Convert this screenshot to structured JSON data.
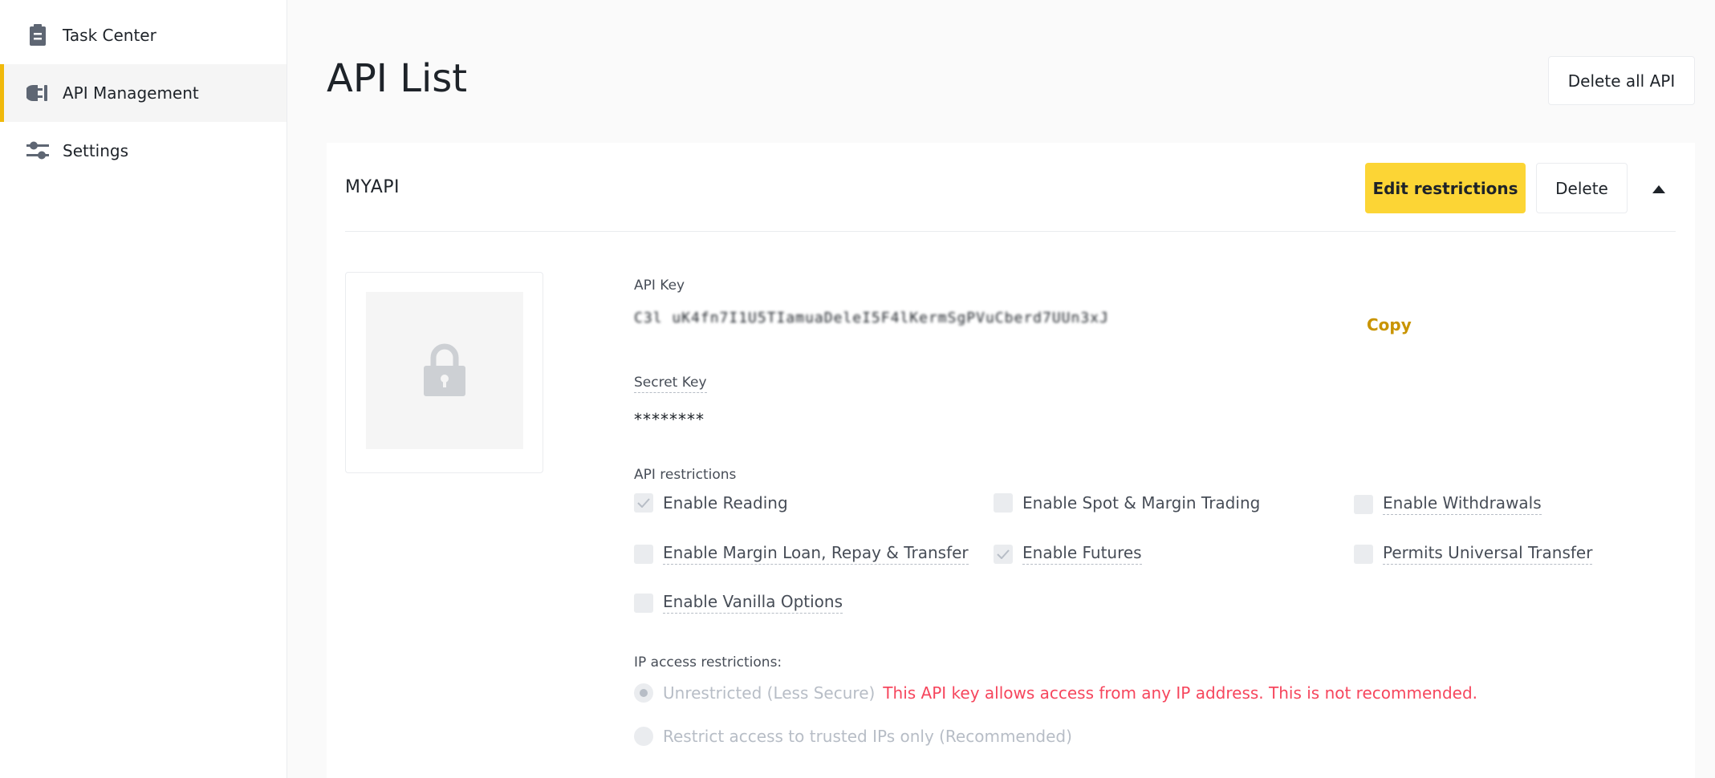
{
  "sidebar": {
    "items": [
      {
        "label": "Task Center",
        "icon": "clipboard-icon",
        "active": false
      },
      {
        "label": "API Management",
        "icon": "plug-icon",
        "active": true
      },
      {
        "label": "Settings",
        "icon": "sliders-icon",
        "active": false
      }
    ]
  },
  "header": {
    "title": "API List",
    "delete_all_label": "Delete all API"
  },
  "api": {
    "name": "MYAPI",
    "edit_label": "Edit restrictions",
    "delete_label": "Delete",
    "api_key_label": "API Key",
    "api_key_value": "C3l  uK4fn7I1U5TIamuaDeleI5F4lKermSgPVuCberd7UUn3xJ",
    "copy_label": "Copy",
    "secret_key_label": "Secret Key",
    "secret_key_value": "********",
    "restrictions_label": "API restrictions",
    "restrictions": [
      {
        "label": "Enable Reading",
        "checked": true
      },
      {
        "label": "Enable Spot & Margin Trading",
        "checked": false
      },
      {
        "label": "Enable Withdrawals",
        "checked": false
      },
      {
        "label": "Enable Margin Loan, Repay & Transfer",
        "checked": false
      },
      {
        "label": "Enable Futures",
        "checked": true
      },
      {
        "label": "Permits Universal Transfer",
        "checked": false
      },
      {
        "label": "Enable Vanilla Options",
        "checked": false
      }
    ],
    "ip_label": "IP access restrictions:",
    "ip_options": [
      {
        "label": "Unrestricted (Less Secure)",
        "selected": true,
        "warning": "This API key allows access from any IP address. This is not recommended."
      },
      {
        "label": "Restrict access to trusted IPs only (Recommended)",
        "selected": false
      }
    ]
  },
  "colors": {
    "accent": "#fcd535",
    "link": "#c99400",
    "warning": "#f6465d"
  }
}
